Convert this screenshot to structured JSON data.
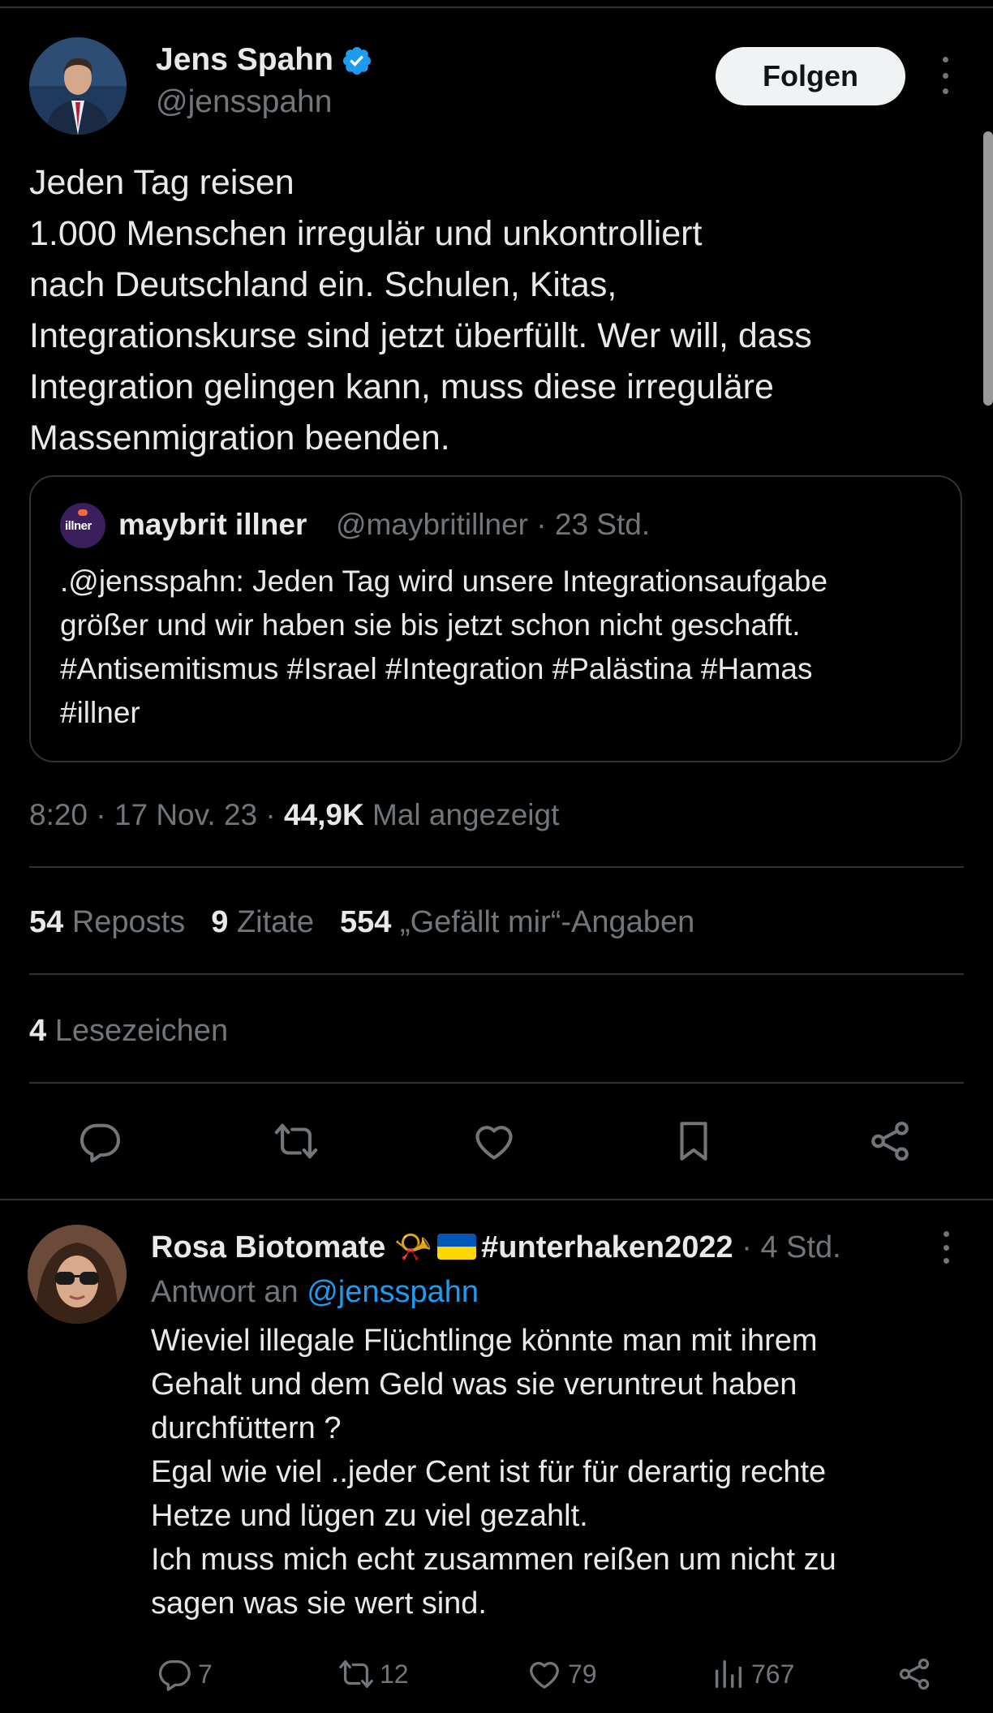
{
  "tweet": {
    "author_name": "Jens Spahn",
    "author_handle": "@jensspahn",
    "follow_label": "Folgen",
    "text_lines": [
      "Jeden Tag reisen",
      "1.000 Menschen irregulär und unkontrolliert",
      "nach Deutschland ein. Schulen, Kitas,",
      "Integrationskurse sind jetzt überfüllt. Wer will, dass",
      "Integration gelingen kann, muss diese irreguläre",
      "Massenmigration beenden."
    ],
    "quote": {
      "avatar_text": "illner",
      "name": "maybrit illner",
      "handle_time": "@maybritillner · 23 Std.",
      "text_lines": [
        ".@jensspahn: Jeden Tag wird unsere Integrationsaufgabe",
        "größer und wir haben sie bis jetzt schon nicht geschafft.",
        "#Antisemitismus #Israel #Integration #Palästina #Hamas",
        "#illner"
      ]
    },
    "meta": {
      "time_date": "8:20 · 17 Nov. 23 · ",
      "views_count": "44,9K",
      "views_label": " Mal angezeigt"
    },
    "stats": {
      "reposts_count": "54",
      "reposts_label": " Reposts",
      "quotes_count": "9",
      "quotes_label": " Zitate",
      "likes_count": "554",
      "likes_label": " „Gefällt mir“-Angaben",
      "bookmarks_count": "4",
      "bookmarks_label": " Lesezeichen"
    },
    "actions": [
      "reply-icon",
      "repost-icon",
      "like-icon",
      "bookmark-icon",
      "share-icon"
    ]
  },
  "reply": {
    "name": "Rosa Biotomate",
    "emoji": "📯",
    "hashtag": "#unterhaken2022",
    "time": " · 4 Std.",
    "reply_prefix": "Antwort an ",
    "reply_handle": "@jensspahn",
    "text_lines": [
      "Wieviel illegale Flüchtlinge könnte man mit ihrem",
      "Gehalt und dem Geld was sie veruntreut haben",
      "durchfüttern ?",
      "Egal wie viel ..jeder Cent ist für für derartig rechte",
      "Hetze und lügen zu viel gezahlt.",
      "Ich muss mich echt zusammen reißen um nicht zu",
      "sagen was sie wert sind."
    ],
    "counts": {
      "replies": "7",
      "reposts": "12",
      "likes": "79",
      "views": "767"
    }
  },
  "colors": {
    "background": "#000000",
    "text": "#e7e9ea",
    "muted": "#71767b",
    "link": "#1d9bf0",
    "divider": "#2f3336",
    "verified": "#1d9bf0"
  }
}
